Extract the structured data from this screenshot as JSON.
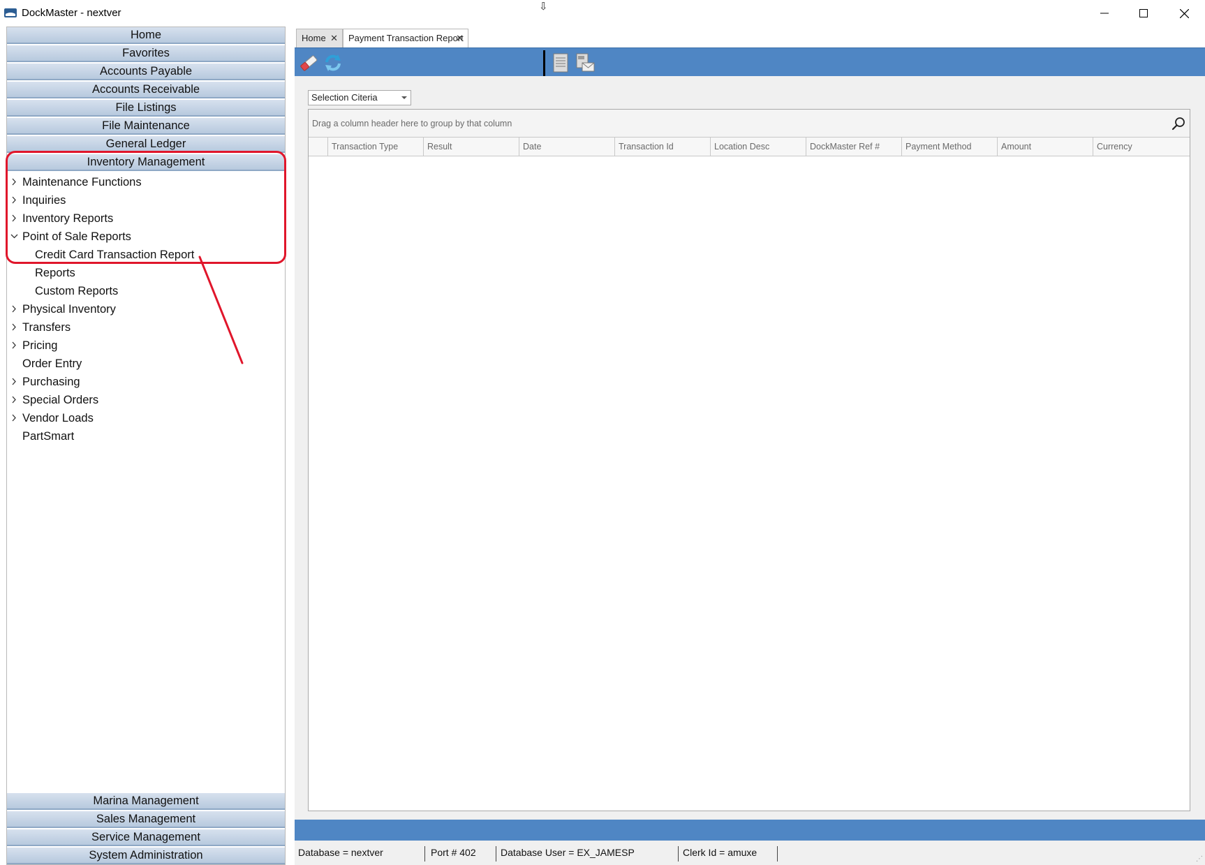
{
  "window": {
    "title": "DockMaster - nextver",
    "controls": {
      "minimize": "—",
      "maximize": "☐",
      "close": "✕"
    }
  },
  "sidebar": {
    "top_sections": [
      "Home",
      "Favorites",
      "Accounts Payable",
      "Accounts Receivable",
      "File Listings",
      "File Maintenance",
      "General Ledger",
      "Inventory Management"
    ],
    "tree": [
      {
        "label": "Maintenance Functions",
        "expander": "collapsed"
      },
      {
        "label": "Inquiries",
        "expander": "collapsed"
      },
      {
        "label": "Inventory Reports",
        "expander": "collapsed"
      },
      {
        "label": "Point of Sale Reports",
        "expander": "expanded"
      },
      {
        "label": "Credit Card Transaction Report",
        "expander": "none",
        "child": true
      },
      {
        "label": "Reports",
        "expander": "none",
        "child": true
      },
      {
        "label": "Custom Reports",
        "expander": "none",
        "child": true
      },
      {
        "label": "Physical Inventory",
        "expander": "collapsed"
      },
      {
        "label": "Transfers",
        "expander": "collapsed"
      },
      {
        "label": "Pricing",
        "expander": "collapsed"
      },
      {
        "label": "Order Entry",
        "expander": "none"
      },
      {
        "label": "Purchasing",
        "expander": "collapsed"
      },
      {
        "label": "Special Orders",
        "expander": "collapsed"
      },
      {
        "label": "Vendor Loads",
        "expander": "collapsed"
      },
      {
        "label": "PartSmart",
        "expander": "none"
      }
    ],
    "bottom_sections": [
      "Marina Management",
      "Sales Management",
      "Service Management",
      "System Administration"
    ]
  },
  "tabs": [
    {
      "label": "Home",
      "active": false
    },
    {
      "label": "Payment Transaction Report",
      "active": true
    }
  ],
  "toolbar": {
    "icons": [
      "eraser-icon",
      "refresh-icon",
      "report-icon",
      "email-pdf-icon"
    ]
  },
  "content": {
    "selection_combo": "Selection Citeria",
    "group_panel_hint": "Drag a column header here to group by that column",
    "columns": [
      "Transaction Type",
      "Result",
      "Date",
      "Transaction Id",
      "Location Desc",
      "DockMaster Ref #",
      "Payment Method",
      "Amount",
      "Currency"
    ],
    "rows": []
  },
  "statusbar": {
    "database": "Database = nextver",
    "port": "Port # 402",
    "db_user": "Database User = EX_JAMESP",
    "clerk": "Clerk Id = amuxe"
  },
  "colors": {
    "toolbar_blue": "#4f86c4",
    "annotation_red": "#e0162b",
    "header_gradient_top": "#d7e1ee",
    "header_gradient_bottom": "#b7c9de"
  }
}
